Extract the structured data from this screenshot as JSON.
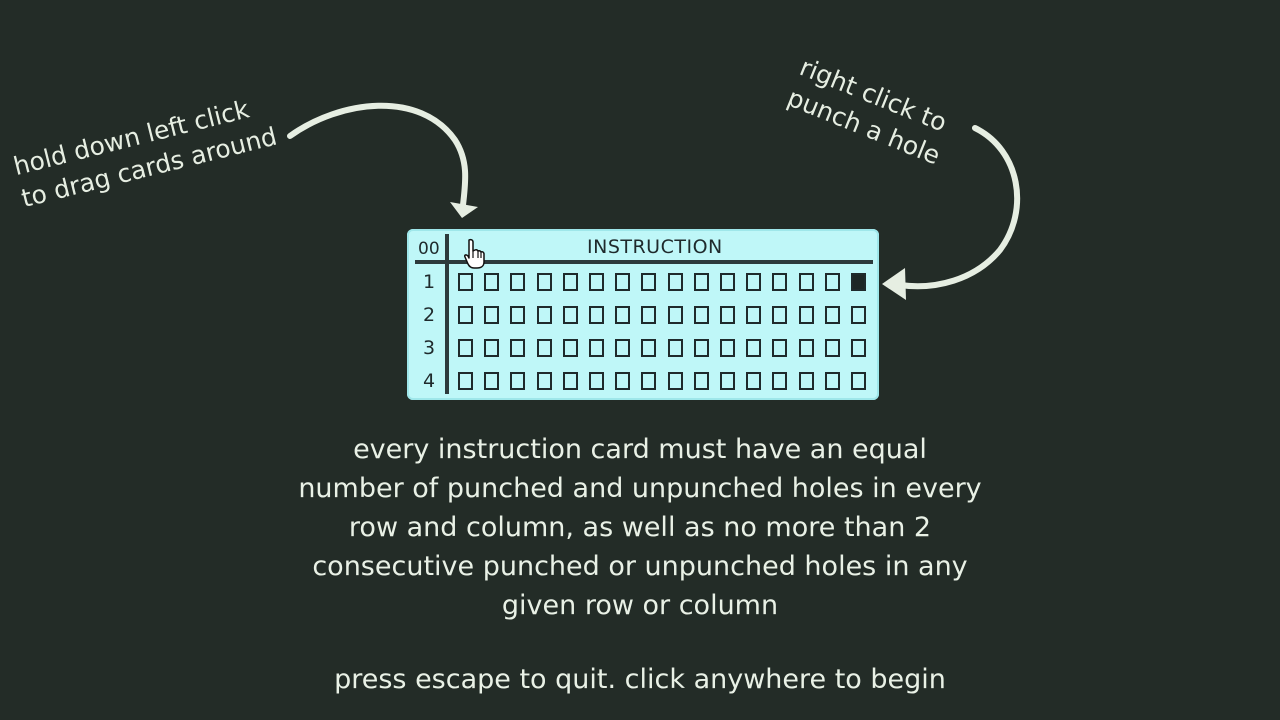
{
  "hints": {
    "left": [
      "hold down left click",
      "to drag cards around"
    ],
    "right": [
      "right click to",
      "punch a hole"
    ]
  },
  "card": {
    "number": "00",
    "title": "INSTRUCTION",
    "rows": [
      {
        "label": "1",
        "holes": [
          0,
          0,
          0,
          0,
          0,
          0,
          0,
          0,
          0,
          0,
          0,
          0,
          0,
          0,
          0,
          1
        ]
      },
      {
        "label": "2",
        "holes": [
          0,
          0,
          0,
          0,
          0,
          0,
          0,
          0,
          0,
          0,
          0,
          0,
          0,
          0,
          0,
          0
        ]
      },
      {
        "label": "3",
        "holes": [
          0,
          0,
          0,
          0,
          0,
          0,
          0,
          0,
          0,
          0,
          0,
          0,
          0,
          0,
          0,
          0
        ]
      },
      {
        "label": "4",
        "holes": [
          0,
          0,
          0,
          0,
          0,
          0,
          0,
          0,
          0,
          0,
          0,
          0,
          0,
          0,
          0,
          0
        ]
      }
    ]
  },
  "rules": [
    "every instruction card must have an equal",
    "number of punched and unpunched holes in every",
    "row and column, as well as no more than 2",
    "consecutive punched or unpunched holes in any",
    "given row or column"
  ],
  "footer": "press escape to quit. click anywhere to begin",
  "icons": {
    "cursor": "hand-pointer-icon"
  },
  "colors": {
    "background": "#232c27",
    "card": "#bff7f8",
    "ink": "#1f2a2c",
    "chalk": "#e6eee2"
  }
}
